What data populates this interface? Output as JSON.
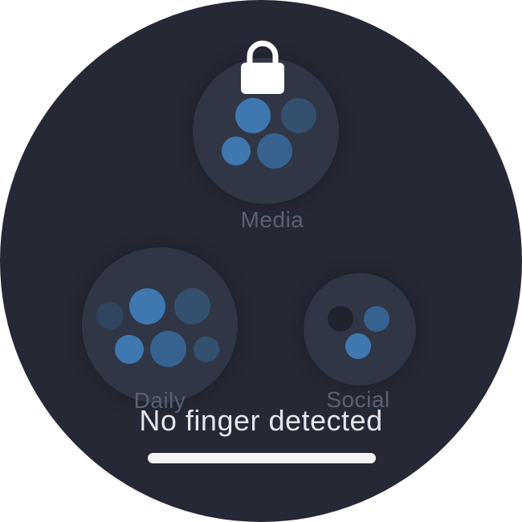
{
  "folders": {
    "media": {
      "label": "Media"
    },
    "daily": {
      "label": "Daily"
    },
    "social": {
      "label": "Social"
    }
  },
  "status": {
    "message": "No finger detected"
  },
  "icons": {
    "lock": "lock-icon",
    "home_indicator": "home-indicator"
  },
  "colors": {
    "background": "#262836",
    "folder": "#303646",
    "app_bright": "#3f78b0",
    "app_dim": "#34506f",
    "app_dark": "#1f2330",
    "label": "#5a6272",
    "status_text": "#e4e6ea"
  }
}
